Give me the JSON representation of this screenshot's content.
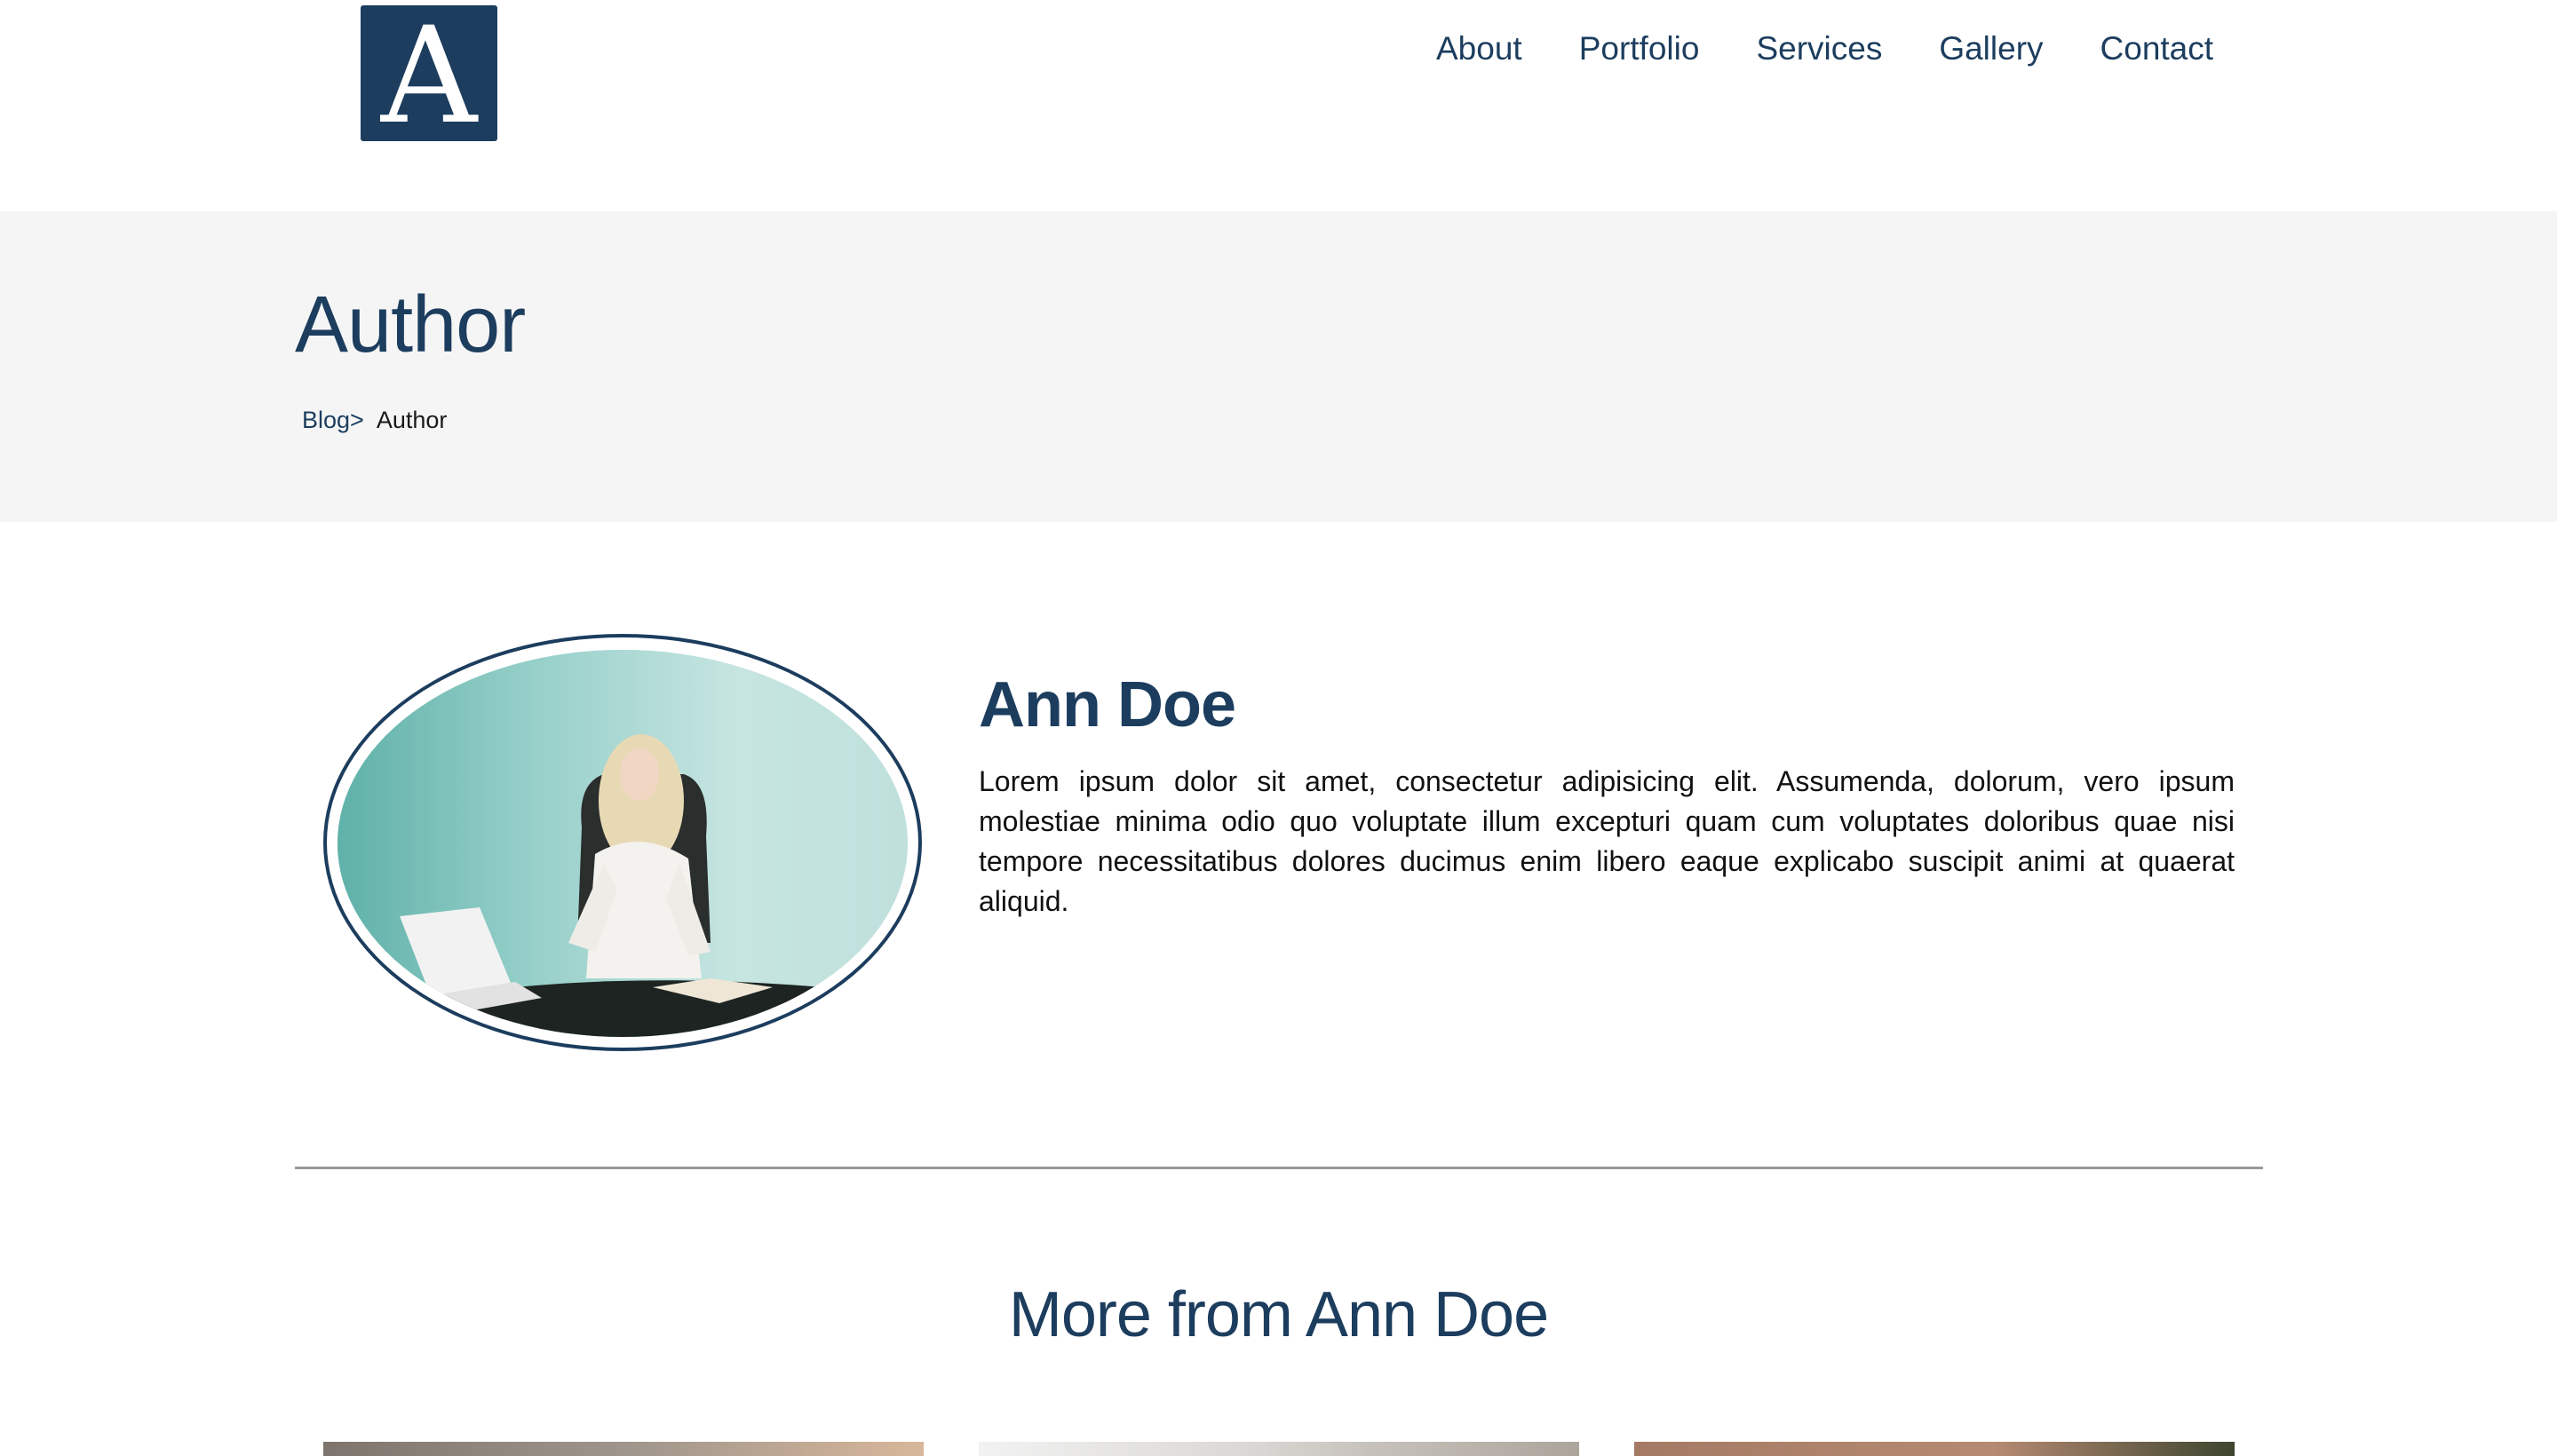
{
  "header": {
    "logo_letter": "A",
    "nav": [
      {
        "label": "About"
      },
      {
        "label": "Portfolio"
      },
      {
        "label": "Services"
      },
      {
        "label": "Gallery"
      },
      {
        "label": "Contact"
      }
    ]
  },
  "hero": {
    "title": "Author",
    "breadcrumb": {
      "link": "Blog>",
      "current": "Author"
    }
  },
  "author": {
    "name": "Ann Doe",
    "bio": "Lorem ipsum dolor sit amet, consectetur adipisicing elit. Assumenda, dolorum, vero ipsum molestiae minima odio quo voluptate illum excepturi quam cum voluptates doloribus quae nisi tempore necessitatibus dolores ducimus enim libero eaque explicabo suscipit animi at quaerat aliquid."
  },
  "more": {
    "title": "More from Ann Doe"
  },
  "colors": {
    "brand": "#1c3d5e",
    "hero_bg": "#f5f5f5",
    "divider": "#999999"
  }
}
